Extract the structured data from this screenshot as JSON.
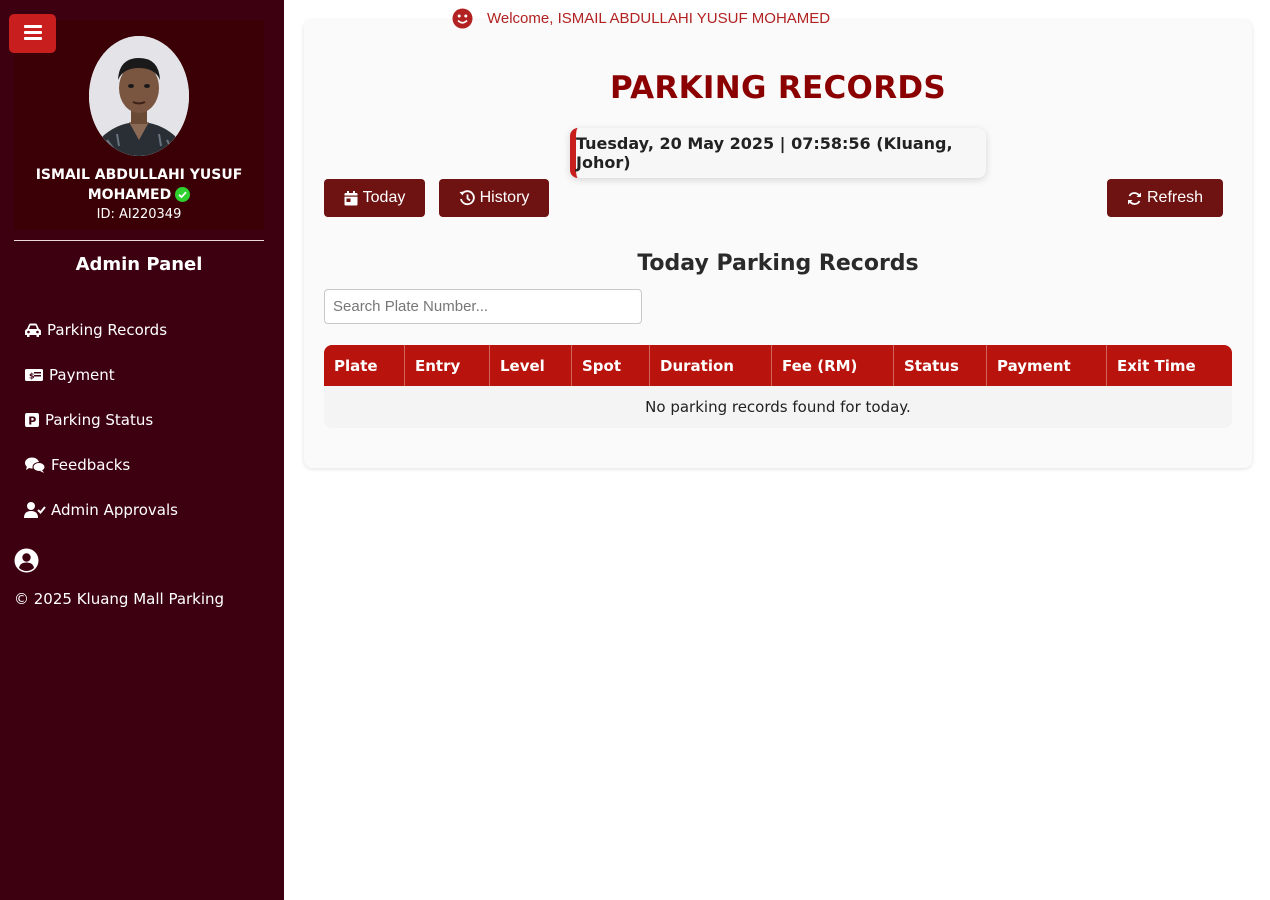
{
  "sidebar": {
    "user_name_line1": "ISMAIL ABDULLAHI YUSUF",
    "user_name_line2": "MOHAMED",
    "user_id": "ID: AI220349",
    "panel_title": "Admin Panel",
    "items": [
      {
        "label": "Parking Records",
        "icon": "car-icon"
      },
      {
        "label": "Payment",
        "icon": "money-bill-icon"
      },
      {
        "label": "Parking Status",
        "icon": "parking-icon"
      },
      {
        "label": "Feedbacks",
        "icon": "comments-icon"
      },
      {
        "label": "Admin Approvals",
        "icon": "user-check-icon"
      }
    ],
    "copyright": "© 2025 Kluang Mall Parking"
  },
  "header": {
    "welcome": "Welcome, ISMAIL ABDULLAHI YUSUF MOHAMED"
  },
  "main": {
    "title": "PARKING RECORDS",
    "datetime": "Tuesday, 20 May 2025 | 07:58:56 (Kluang, Johor)",
    "buttons": {
      "today": "Today",
      "history": "History",
      "refresh": "Refresh"
    },
    "section_title": "Today Parking Records",
    "search_placeholder": "Search Plate Number...",
    "table": {
      "columns": [
        "Plate",
        "Entry",
        "Level",
        "Spot",
        "Duration",
        "Fee (RM)",
        "Status",
        "Payment",
        "Exit Time"
      ],
      "empty_message": "No parking records found for today."
    }
  },
  "colors": {
    "sidebar_bg": "#3d0010",
    "accent_red": "#c81e1e",
    "title_red": "#8b0000",
    "button_bg": "#6e1212",
    "table_header": "#b8140d",
    "verified_green": "#2fd12f"
  }
}
